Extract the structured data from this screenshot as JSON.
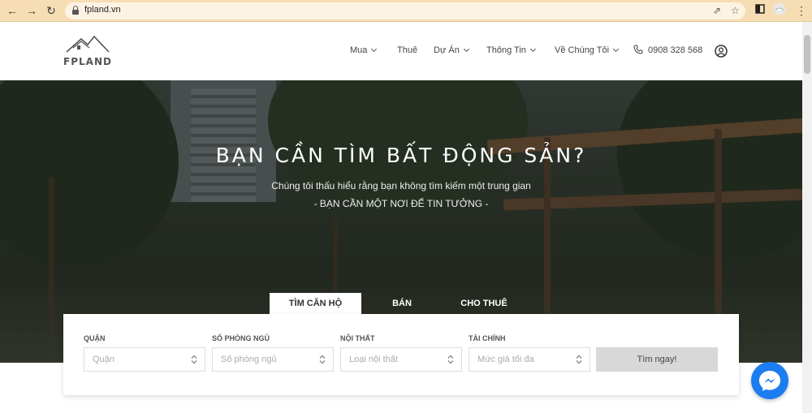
{
  "browser": {
    "url": "fpland.vn",
    "icons": [
      "back-icon",
      "forward-icon",
      "reload-icon",
      "lock-icon",
      "share-icon",
      "star-icon",
      "sidebar-icon",
      "profile-icon",
      "menu-icon"
    ]
  },
  "header": {
    "logo_text": "FPLAND",
    "nav": [
      {
        "label": "Mua",
        "dropdown": true
      },
      {
        "label": "Thuê",
        "dropdown": false
      },
      {
        "label": "Dự Án",
        "dropdown": true
      },
      {
        "label": "Thông Tin",
        "dropdown": true
      },
      {
        "label": "Về Chúng Tôi",
        "dropdown": true
      }
    ],
    "phone": "0908 328 568"
  },
  "hero": {
    "title": "BẠN CẦN TÌM BẤT ĐỘNG SẢN?",
    "subtitle": "Chúng tôi thấu hiểu rằng bạn không tìm kiếm một trung gian",
    "tagline": "- BẠN CẦN MỘT NƠI ĐỂ TIN TƯỞNG -"
  },
  "tabs": [
    {
      "label": "TÌM CĂN HỘ",
      "active": true
    },
    {
      "label": "BÁN",
      "active": false
    },
    {
      "label": "CHO THUÊ",
      "active": false
    }
  ],
  "search": {
    "fields": [
      {
        "label": "QUẬN",
        "placeholder": "Quận"
      },
      {
        "label": "SỐ PHÒNG NGỦ",
        "placeholder": "Số phòng ngủ"
      },
      {
        "label": "NỘI THẤT",
        "placeholder": "Loại nội thất"
      },
      {
        "label": "TÀI CHÍNH",
        "placeholder": "Mức giá tối đa"
      }
    ],
    "button_label": "Tìm ngay!"
  },
  "colors": {
    "chrome": "#f6ddb4",
    "messenger": "#1c7df0",
    "search_button": "#d8d8d8"
  }
}
